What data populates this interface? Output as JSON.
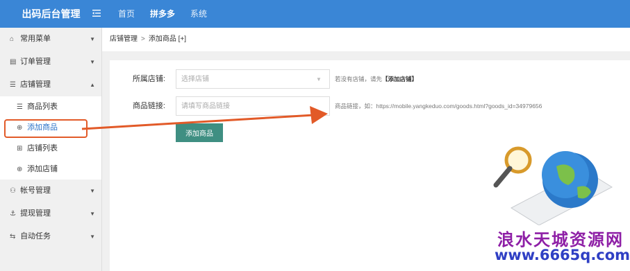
{
  "app": {
    "title": "出码后台管理"
  },
  "topnav": {
    "items": [
      "首页",
      "拼多多",
      "系统"
    ],
    "active_index": 1
  },
  "sidebar": {
    "common_menu": "常用菜单",
    "orders": "订单管理",
    "shop": "店铺管理",
    "shop_items": [
      "商品列表",
      "添加商品",
      "店铺列表",
      "添加店铺"
    ],
    "accounts": "帐号管理",
    "withdraw": "提现管理",
    "auto_tasks": "自动任务"
  },
  "breadcrumb": {
    "parent": "店铺管理",
    "separator": ">",
    "current": "添加商品",
    "extra": "[+]"
  },
  "form": {
    "shop_label": "所属店铺:",
    "shop_placeholder": "选择店铺",
    "shop_hint_prefix": "若没有店铺，请先",
    "shop_hint_link": "【添加店铺】",
    "link_label": "商品链接:",
    "link_placeholder": "请填写商品链接",
    "link_hint": "商品链接，如：https://mobile.yangkeduo.com/goods.html?goods_id=34979656",
    "submit_label": "添加商品"
  },
  "watermark": {
    "line1": "浪水天城资源网",
    "line2": "www.6665q.com"
  },
  "colors": {
    "header": "#3a86d6",
    "button": "#3f8f82",
    "annotation": "#e25a28",
    "watermark1": "#8e1fa6",
    "watermark2": "#2f3fc4"
  }
}
